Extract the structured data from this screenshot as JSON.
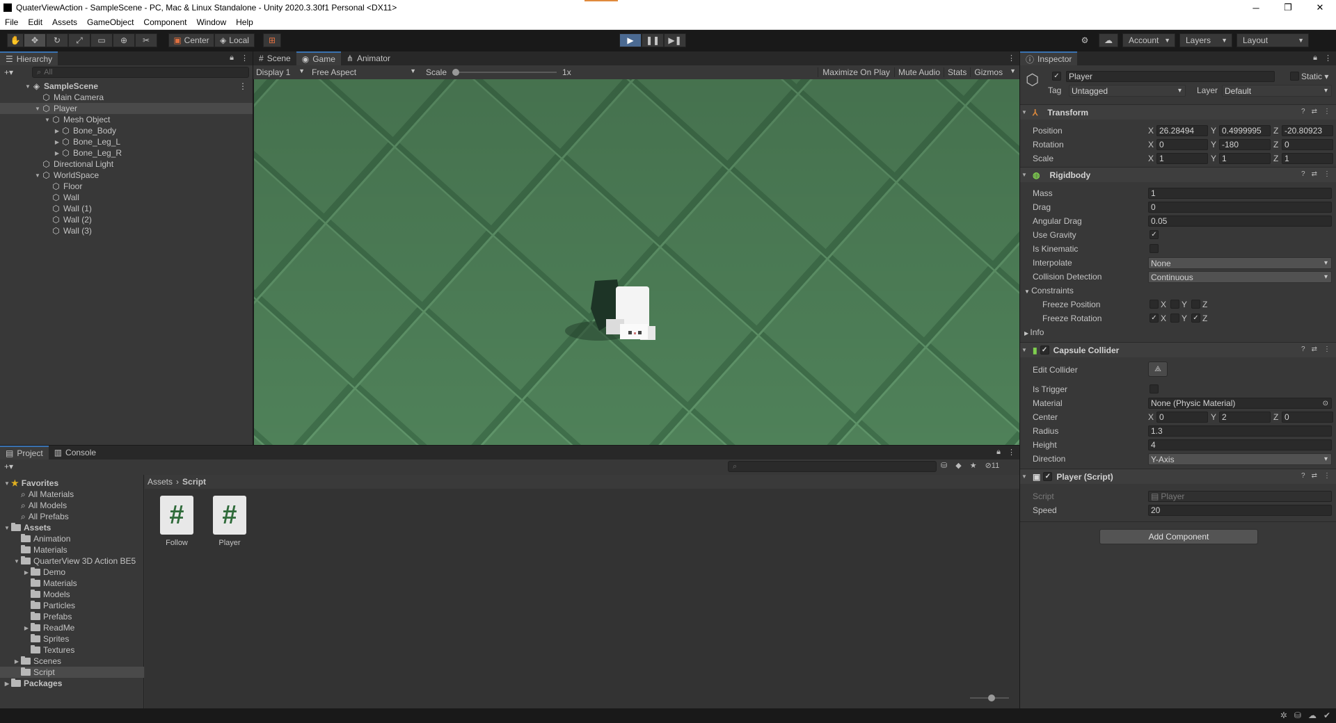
{
  "window": {
    "title": "QuaterViewAction - SampleScene - PC, Mac & Linux Standalone - Unity 2020.3.30f1 Personal <DX11>",
    "minimize": "─",
    "maximize": "❐",
    "close": "✕"
  },
  "menu": [
    "File",
    "Edit",
    "Assets",
    "GameObject",
    "Component",
    "Window",
    "Help"
  ],
  "toolbar": {
    "pivot": "Center",
    "space": "Local",
    "account": "Account",
    "layers": "Layers",
    "layout": "Layout"
  },
  "hierarchy": {
    "tab": "Hierarchy",
    "search_placeholder": "All",
    "items": [
      {
        "label": "SampleScene",
        "depth": 0,
        "expanded": true,
        "scene": true
      },
      {
        "label": "Main Camera",
        "depth": 1
      },
      {
        "label": "Player",
        "depth": 1,
        "expanded": true,
        "selected": true
      },
      {
        "label": "Mesh Object",
        "depth": 2,
        "expanded": true
      },
      {
        "label": "Bone_Body",
        "depth": 3,
        "collapsed": true
      },
      {
        "label": "Bone_Leg_L",
        "depth": 3,
        "collapsed": true
      },
      {
        "label": "Bone_Leg_R",
        "depth": 3,
        "collapsed": true
      },
      {
        "label": "Directional Light",
        "depth": 1
      },
      {
        "label": "WorldSpace",
        "depth": 1,
        "expanded": true
      },
      {
        "label": "Floor",
        "depth": 2
      },
      {
        "label": "Wall",
        "depth": 2
      },
      {
        "label": "Wall (1)",
        "depth": 2
      },
      {
        "label": "Wall (2)",
        "depth": 2
      },
      {
        "label": "Wall (3)",
        "depth": 2
      }
    ]
  },
  "game": {
    "tabs": [
      "Scene",
      "Game",
      "Animator"
    ],
    "display": "Display 1",
    "aspect": "Free Aspect",
    "scale_label": "Scale",
    "scale_value": "1x",
    "maximize": "Maximize On Play",
    "mute": "Mute Audio",
    "stats": "Stats",
    "gizmos": "Gizmos",
    "floor_color": "#4e7f58"
  },
  "project": {
    "tabs": [
      "Project",
      "Console"
    ],
    "hidden_count": "11",
    "favorites_label": "Favorites",
    "favorites": [
      "All Materials",
      "All Models",
      "All Prefabs"
    ],
    "assets_label": "Assets",
    "tree": [
      {
        "label": "Animation",
        "depth": 1
      },
      {
        "label": "Materials",
        "depth": 1
      },
      {
        "label": "QuarterView 3D Action BE5",
        "depth": 1,
        "expanded": true
      },
      {
        "label": "Demo",
        "depth": 2,
        "collapsed": true
      },
      {
        "label": "Materials",
        "depth": 2
      },
      {
        "label": "Models",
        "depth": 2
      },
      {
        "label": "Particles",
        "depth": 2
      },
      {
        "label": "Prefabs",
        "depth": 2
      },
      {
        "label": "ReadMe",
        "depth": 2,
        "collapsed": true
      },
      {
        "label": "Sprites",
        "depth": 2
      },
      {
        "label": "Textures",
        "depth": 2
      },
      {
        "label": "Scenes",
        "depth": 1,
        "collapsed": true
      },
      {
        "label": "Script",
        "depth": 1,
        "selected": true
      }
    ],
    "packages_label": "Packages",
    "breadcrumb": [
      "Assets",
      "Script"
    ],
    "files": [
      "Follow",
      "Player"
    ]
  },
  "inspector": {
    "tab": "Inspector",
    "object_name": "Player",
    "static_label": "Static",
    "tag_label": "Tag",
    "tag_value": "Untagged",
    "layer_label": "Layer",
    "layer_value": "Default",
    "transform": {
      "title": "Transform",
      "position": [
        "26.28494",
        "0.4999995",
        "-20.80923"
      ],
      "rotation": [
        "0",
        "-180",
        "0"
      ],
      "scale": [
        "1",
        "1",
        "1"
      ],
      "labels": [
        "Position",
        "Rotation",
        "Scale"
      ]
    },
    "rigidbody": {
      "title": "Rigidbody",
      "mass": "1",
      "drag": "0",
      "angular_drag": "0.05",
      "interpolate": "None",
      "collision": "Continuous",
      "labels": {
        "mass": "Mass",
        "drag": "Drag",
        "angular": "Angular Drag",
        "gravity": "Use Gravity",
        "kinematic": "Is Kinematic",
        "interpolate": "Interpolate",
        "collision": "Collision Detection",
        "constraints": "Constraints",
        "freeze_pos": "Freeze Position",
        "freeze_rot": "Freeze Rotation",
        "info": "Info"
      }
    },
    "capsule": {
      "title": "Capsule Collider",
      "material": "None (Physic Material)",
      "center": [
        "0",
        "2",
        "0"
      ],
      "radius": "1.3",
      "height": "4",
      "direction": "Y-Axis",
      "labels": {
        "edit": "Edit Collider",
        "trigger": "Is Trigger",
        "material": "Material",
        "center": "Center",
        "radius": "Radius",
        "height": "Height",
        "direction": "Direction"
      }
    },
    "script": {
      "title": "Player (Script)",
      "script_label": "Script",
      "script_value": "Player",
      "speed_label": "Speed",
      "speed": "20"
    },
    "add_component": "Add Component",
    "axes": [
      "X",
      "Y",
      "Z"
    ]
  }
}
